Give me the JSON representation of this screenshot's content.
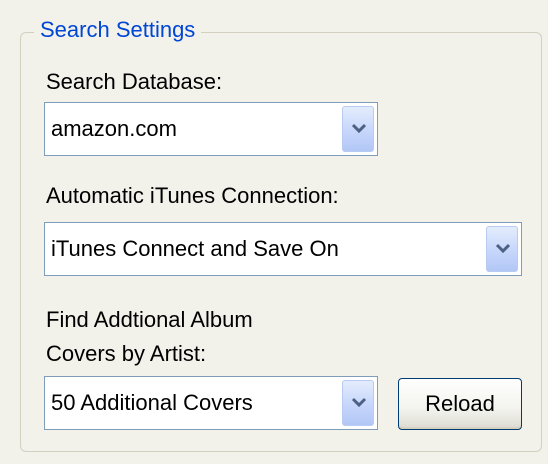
{
  "group": {
    "title": "Search Settings"
  },
  "search_database": {
    "label": "Search Database:",
    "value": "amazon.com"
  },
  "itunes_connection": {
    "label": "Automatic iTunes Connection:",
    "value": "iTunes Connect and Save On"
  },
  "additional_covers": {
    "label_line1": "Find Addtional Album",
    "label_line2": "Covers by Artist:",
    "value": "50 Additional Covers"
  },
  "reload_button": {
    "label": "Reload"
  },
  "icons": {
    "dropdown": "chevron-down-icon"
  },
  "colors": {
    "legend": "#0046d5",
    "arrow_glyph": "#4d6185"
  }
}
